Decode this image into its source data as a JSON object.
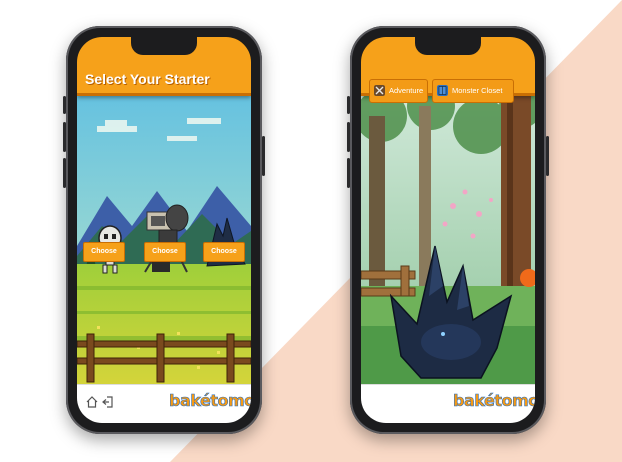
{
  "left_phone": {
    "header_title": "Select Your Starter",
    "choose_buttons": [
      "Choose",
      "Choose",
      "Choose"
    ],
    "brand": "bakétomo"
  },
  "right_phone": {
    "tabs": [
      {
        "label": "Adventure",
        "icon": "crossed-swords-icon"
      },
      {
        "label": "Monster Closet",
        "icon": "closet-icon"
      }
    ],
    "brand": "bakétomo"
  },
  "footer": {
    "home_icon": "home-icon",
    "logout_icon": "logout-icon"
  },
  "colors": {
    "background_peach": "#f9d9c6",
    "header_orange": "#f6a11a",
    "brand_blue": "#2a6fbf"
  }
}
